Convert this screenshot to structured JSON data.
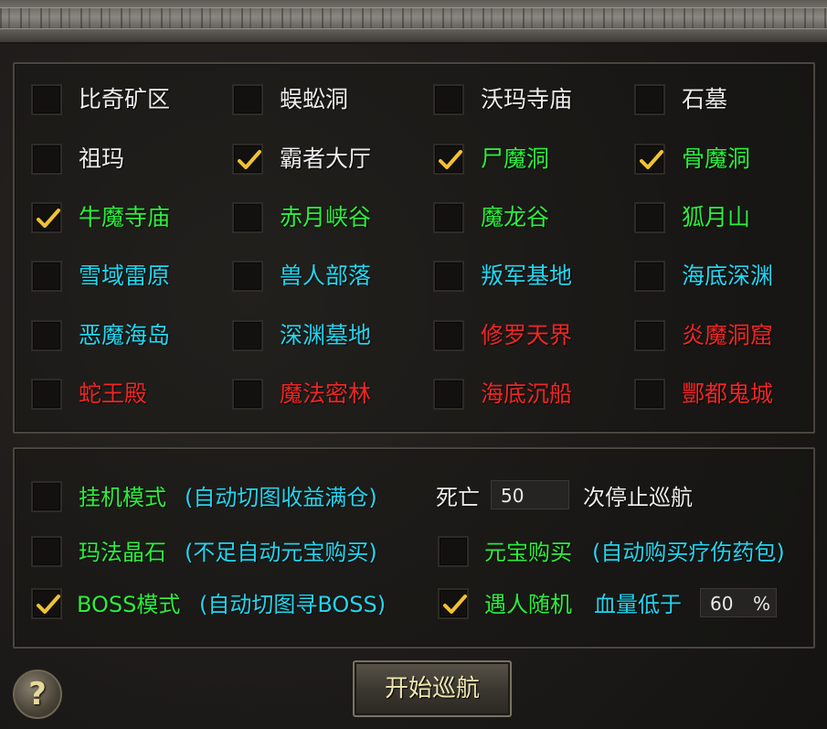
{
  "maps": [
    {
      "label": "比奇矿区",
      "color": "white",
      "checked": false
    },
    {
      "label": "蜈蚣洞",
      "color": "white",
      "checked": false
    },
    {
      "label": "沃玛寺庙",
      "color": "white",
      "checked": false
    },
    {
      "label": "石墓",
      "color": "white",
      "checked": false
    },
    {
      "label": "祖玛",
      "color": "white",
      "checked": false
    },
    {
      "label": "霸者大厅",
      "color": "white",
      "checked": true
    },
    {
      "label": "尸魔洞",
      "color": "green",
      "checked": true
    },
    {
      "label": "骨魔洞",
      "color": "green",
      "checked": true
    },
    {
      "label": "牛魔寺庙",
      "color": "green",
      "checked": true
    },
    {
      "label": "赤月峡谷",
      "color": "green",
      "checked": false
    },
    {
      "label": "魔龙谷",
      "color": "green",
      "checked": false
    },
    {
      "label": "狐月山",
      "color": "green",
      "checked": false
    },
    {
      "label": "雪域雷原",
      "color": "cyan",
      "checked": false
    },
    {
      "label": "兽人部落",
      "color": "cyan",
      "checked": false
    },
    {
      "label": "叛军基地",
      "color": "cyan",
      "checked": false
    },
    {
      "label": "海底深渊",
      "color": "cyan",
      "checked": false
    },
    {
      "label": "恶魔海岛",
      "color": "cyan",
      "checked": false
    },
    {
      "label": "深渊墓地",
      "color": "cyan",
      "checked": false
    },
    {
      "label": "修罗天界",
      "color": "red",
      "checked": false
    },
    {
      "label": "炎魔洞窟",
      "color": "red",
      "checked": false
    },
    {
      "label": "蛇王殿",
      "color": "red",
      "checked": false
    },
    {
      "label": "魔法密林",
      "color": "red",
      "checked": false
    },
    {
      "label": "海底沉船",
      "color": "red",
      "checked": false
    },
    {
      "label": "酆都鬼城",
      "color": "red",
      "checked": false
    }
  ],
  "options": {
    "hangup": {
      "checked": false,
      "label": "挂机模式",
      "desc": "(自动切图收益满仓)"
    },
    "death": {
      "prefix": "死亡",
      "value": "50",
      "suffix": "次停止巡航"
    },
    "crystal": {
      "checked": false,
      "label": "玛法晶石",
      "desc": "(不足自动元宝购买)"
    },
    "ingot": {
      "checked": false,
      "label": "元宝购买",
      "desc": "(自动购买疗伤药包)"
    },
    "boss": {
      "checked": true,
      "label": "BOSS模式",
      "desc": "(自动切图寻BOSS)"
    },
    "random": {
      "checked": true,
      "label": "遇人随机",
      "hp_prefix": "血量低于",
      "hp_value": "60",
      "hp_unit": "%"
    }
  },
  "start_button": "开始巡航",
  "help_icon": "?",
  "colors": {
    "white": "#ececec",
    "green": "#2aef3c",
    "cyan": "#22d6ef",
    "red": "#ef2626",
    "tick": "#f2c233"
  }
}
